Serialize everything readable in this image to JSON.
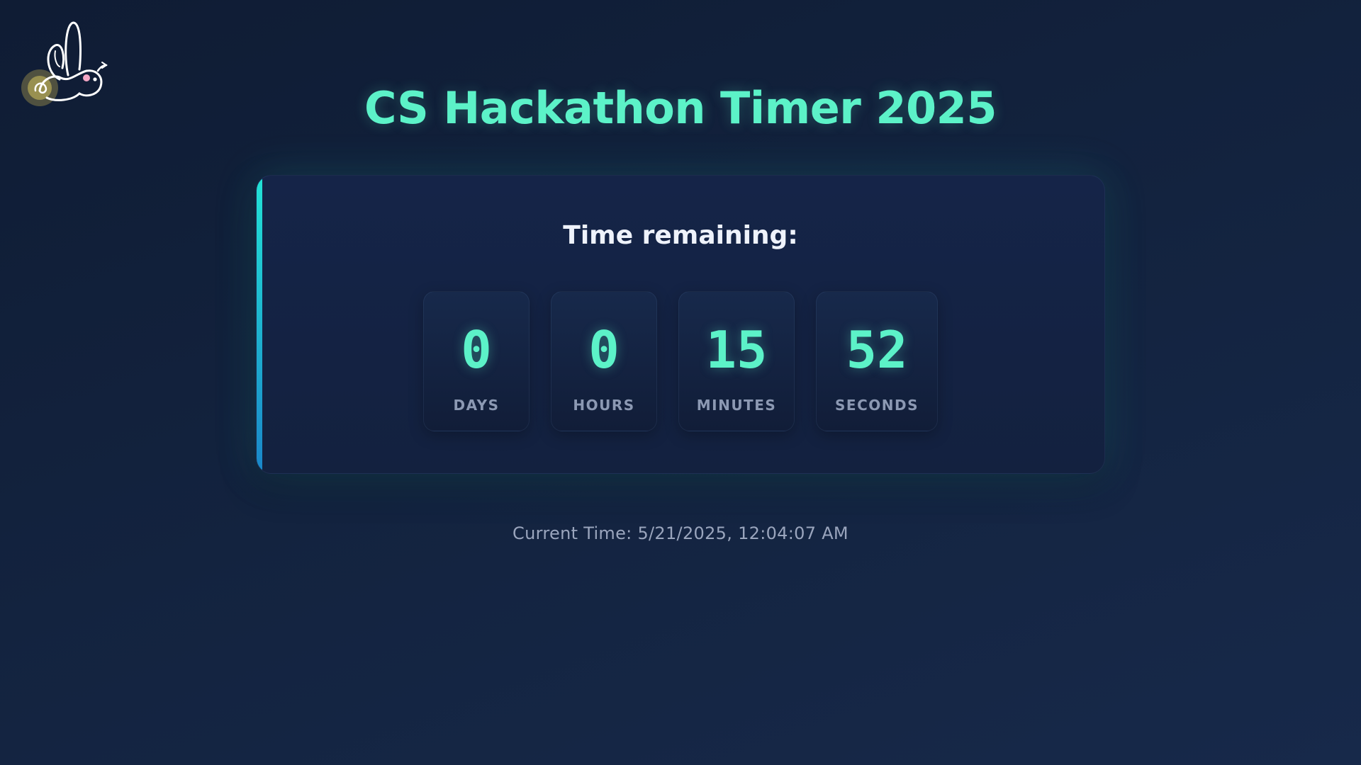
{
  "logo": {
    "icon": "bunny-logo-icon"
  },
  "header": {
    "title": "CS Hackathon Timer 2025"
  },
  "countdown": {
    "heading": "Time remaining:",
    "units": [
      {
        "value": "0",
        "label": "DAYS"
      },
      {
        "value": "0",
        "label": "HOURS"
      },
      {
        "value": "15",
        "label": "MINUTES"
      },
      {
        "value": "52",
        "label": "SECONDS"
      }
    ]
  },
  "footer": {
    "current_time": "Current Time: 5/21/2025, 12:04:07 AM"
  },
  "colors": {
    "accent": "#5cf2c8",
    "background": "#13233f",
    "card": "#152448",
    "accent_bar_top": "#22e3d6",
    "accent_bar_bottom": "#1a86c9",
    "label": "#8c99b3"
  }
}
